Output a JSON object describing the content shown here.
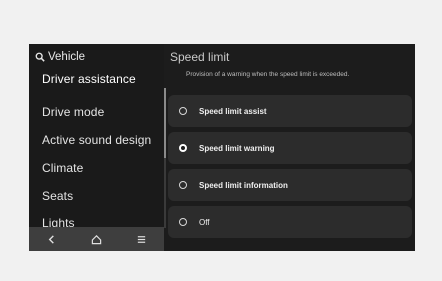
{
  "sidebar": {
    "back_label": "Vehicle",
    "items": [
      {
        "label": "Driver assistance",
        "selected": true
      },
      {
        "label": "Drive mode",
        "selected": false
      },
      {
        "label": "Active sound design",
        "selected": false
      },
      {
        "label": "Climate",
        "selected": false
      },
      {
        "label": "Seats",
        "selected": false
      },
      {
        "label": "Lights",
        "selected": false
      }
    ],
    "nav": [
      {
        "icon": "back-icon"
      },
      {
        "icon": "home-icon"
      },
      {
        "icon": "menu-icon"
      }
    ]
  },
  "panel": {
    "title": "Speed limit",
    "description": "Provision of a warning when the speed limit is exceeded.",
    "options": [
      {
        "label": "Speed limit assist",
        "checked": false
      },
      {
        "label": "Speed limit warning",
        "checked": true
      },
      {
        "label": "Speed limit information",
        "checked": false
      },
      {
        "label": "Off",
        "checked": false
      }
    ]
  },
  "colors": {
    "screen_bg": "#1c1c1c",
    "option_bg": "#2c2c2c",
    "nav_bar": "#3e3e3e",
    "page_bg": "#f1f1f1"
  }
}
